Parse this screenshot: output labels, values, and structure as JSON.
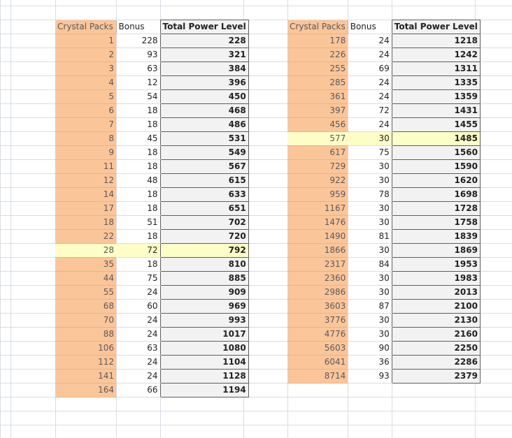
{
  "sheet": {
    "left_table": {
      "headers": {
        "packs": "Crystal Packs",
        "bonus": "Bonus",
        "total": "Total Power Level"
      },
      "rows": [
        {
          "packs": "1",
          "bonus": "228",
          "total": "228"
        },
        {
          "packs": "2",
          "bonus": "93",
          "total": "321"
        },
        {
          "packs": "3",
          "bonus": "63",
          "total": "384"
        },
        {
          "packs": "4",
          "bonus": "12",
          "total": "396"
        },
        {
          "packs": "5",
          "bonus": "54",
          "total": "450"
        },
        {
          "packs": "6",
          "bonus": "18",
          "total": "468"
        },
        {
          "packs": "7",
          "bonus": "18",
          "total": "486"
        },
        {
          "packs": "8",
          "bonus": "45",
          "total": "531"
        },
        {
          "packs": "9",
          "bonus": "18",
          "total": "549"
        },
        {
          "packs": "11",
          "bonus": "18",
          "total": "567"
        },
        {
          "packs": "12",
          "bonus": "48",
          "total": "615"
        },
        {
          "packs": "14",
          "bonus": "18",
          "total": "633"
        },
        {
          "packs": "17",
          "bonus": "18",
          "total": "651"
        },
        {
          "packs": "18",
          "bonus": "51",
          "total": "702"
        },
        {
          "packs": "22",
          "bonus": "18",
          "total": "720"
        },
        {
          "packs": "28",
          "bonus": "72",
          "total": "792",
          "highlight": true
        },
        {
          "packs": "35",
          "bonus": "18",
          "total": "810"
        },
        {
          "packs": "44",
          "bonus": "75",
          "total": "885"
        },
        {
          "packs": "55",
          "bonus": "24",
          "total": "909"
        },
        {
          "packs": "68",
          "bonus": "60",
          "total": "969"
        },
        {
          "packs": "70",
          "bonus": "24",
          "total": "993"
        },
        {
          "packs": "88",
          "bonus": "24",
          "total": "1017"
        },
        {
          "packs": "106",
          "bonus": "63",
          "total": "1080"
        },
        {
          "packs": "112",
          "bonus": "24",
          "total": "1104"
        },
        {
          "packs": "141",
          "bonus": "24",
          "total": "1128"
        },
        {
          "packs": "164",
          "bonus": "66",
          "total": "1194"
        }
      ]
    },
    "right_table": {
      "headers": {
        "packs": "Crystal Packs",
        "bonus": "Bonus",
        "total": "Total Power Level"
      },
      "rows": [
        {
          "packs": "178",
          "bonus": "24",
          "total": "1218"
        },
        {
          "packs": "226",
          "bonus": "24",
          "total": "1242"
        },
        {
          "packs": "255",
          "bonus": "69",
          "total": "1311"
        },
        {
          "packs": "285",
          "bonus": "24",
          "total": "1335"
        },
        {
          "packs": "361",
          "bonus": "24",
          "total": "1359"
        },
        {
          "packs": "397",
          "bonus": "72",
          "total": "1431"
        },
        {
          "packs": "456",
          "bonus": "24",
          "total": "1455"
        },
        {
          "packs": "577",
          "bonus": "30",
          "total": "1485",
          "highlight": true
        },
        {
          "packs": "617",
          "bonus": "75",
          "total": "1560"
        },
        {
          "packs": "729",
          "bonus": "30",
          "total": "1590"
        },
        {
          "packs": "922",
          "bonus": "30",
          "total": "1620"
        },
        {
          "packs": "959",
          "bonus": "78",
          "total": "1698"
        },
        {
          "packs": "1167",
          "bonus": "30",
          "total": "1728"
        },
        {
          "packs": "1476",
          "bonus": "30",
          "total": "1758"
        },
        {
          "packs": "1490",
          "bonus": "81",
          "total": "1839"
        },
        {
          "packs": "1866",
          "bonus": "30",
          "total": "1869"
        },
        {
          "packs": "2317",
          "bonus": "84",
          "total": "1953"
        },
        {
          "packs": "2360",
          "bonus": "30",
          "total": "1983"
        },
        {
          "packs": "2986",
          "bonus": "30",
          "total": "2013"
        },
        {
          "packs": "3603",
          "bonus": "87",
          "total": "2100"
        },
        {
          "packs": "3776",
          "bonus": "30",
          "total": "2130"
        },
        {
          "packs": "4776",
          "bonus": "30",
          "total": "2160"
        },
        {
          "packs": "5603",
          "bonus": "90",
          "total": "2250"
        },
        {
          "packs": "6041",
          "bonus": "36",
          "total": "2286"
        },
        {
          "packs": "8714",
          "bonus": "93",
          "total": "2379"
        }
      ]
    },
    "colors": {
      "pack_fill": "#fbc59a",
      "total_fill": "#f2f2f2",
      "highlight_fill": "#fdfdc7",
      "gridline": "#d9dde6"
    }
  }
}
